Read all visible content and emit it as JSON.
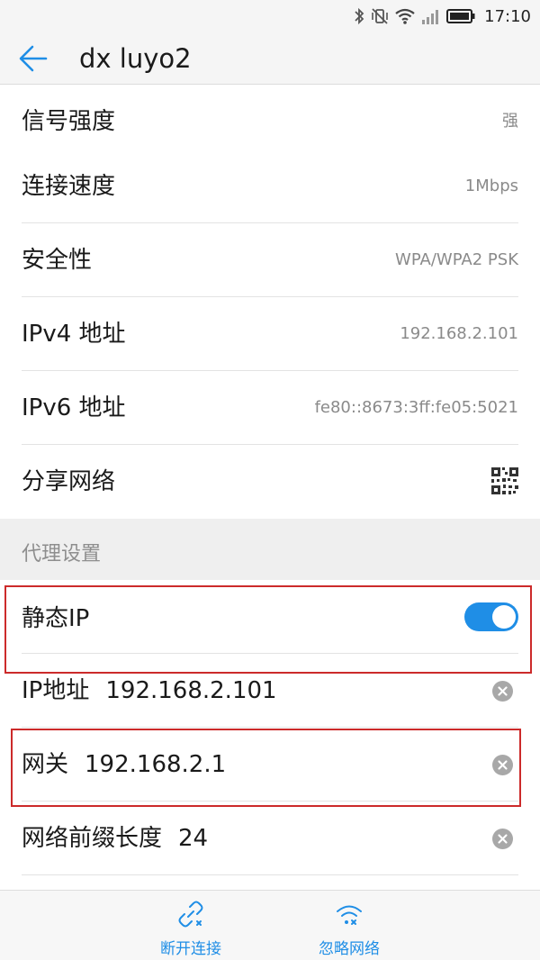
{
  "status_bar": {
    "time": "17:10",
    "icons": [
      "bluetooth-icon",
      "vibrate-off-icon",
      "wifi-icon",
      "signal-icon",
      "battery-icon"
    ]
  },
  "header": {
    "title": "dx luyo2",
    "back_icon": "back-arrow-icon"
  },
  "info_rows": [
    {
      "label": "信号强度",
      "value": "强"
    },
    {
      "label": "连接速度",
      "value": "1Mbps"
    },
    {
      "label": "安全性",
      "value": "WPA/WPA2 PSK"
    },
    {
      "label": "IPv4 地址",
      "value": "192.168.2.101"
    },
    {
      "label": "IPv6 地址",
      "value": "fe80::8673:3ff:fe05:5021"
    }
  ],
  "share": {
    "label": "分享网络",
    "icon": "qr-code-icon"
  },
  "section": {
    "label": "代理设置"
  },
  "static_ip": {
    "label": "静态IP",
    "enabled": true
  },
  "fields": [
    {
      "label": "IP地址",
      "value": "192.168.2.101"
    },
    {
      "label": "网关",
      "value": "192.168.2.1"
    },
    {
      "label": "网络前缀长度",
      "value": "24"
    }
  ],
  "bottom_bar": {
    "disconnect_label": "断开连接",
    "forget_label": "忽略网络"
  },
  "colors": {
    "accent": "#1f8ee6",
    "highlight": "#cc2a2a"
  }
}
